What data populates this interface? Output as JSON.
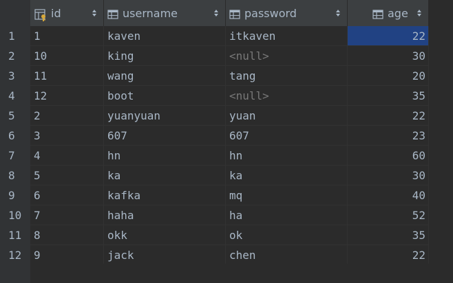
{
  "columns": [
    {
      "label": "id",
      "icon": "primary-key-column-icon"
    },
    {
      "label": "username",
      "icon": "table-column-icon"
    },
    {
      "label": "password",
      "icon": "table-column-icon"
    },
    {
      "label": "age",
      "icon": "table-column-icon"
    }
  ],
  "rows": [
    {
      "num": "1",
      "id": "1",
      "username": "kaven",
      "password": "itkaven",
      "age": "22"
    },
    {
      "num": "2",
      "id": "10",
      "username": "king",
      "password": "<null>",
      "age": "30"
    },
    {
      "num": "3",
      "id": "11",
      "username": "wang",
      "password": "tang",
      "age": "20"
    },
    {
      "num": "4",
      "id": "12",
      "username": "boot",
      "password": "<null>",
      "age": "35"
    },
    {
      "num": "5",
      "id": "2",
      "username": "yuanyuan",
      "password": "yuan",
      "age": "22"
    },
    {
      "num": "6",
      "id": "3",
      "username": "607",
      "password": "607",
      "age": "23"
    },
    {
      "num": "7",
      "id": "4",
      "username": "hn",
      "password": "hn",
      "age": "60"
    },
    {
      "num": "8",
      "id": "5",
      "username": "ka",
      "password": "ka",
      "age": "30"
    },
    {
      "num": "9",
      "id": "6",
      "username": "kafka",
      "password": "mq",
      "age": "40"
    },
    {
      "num": "10",
      "id": "7",
      "username": "haha",
      "password": "ha",
      "age": "52"
    },
    {
      "num": "11",
      "id": "8",
      "username": "okk",
      "password": "ok",
      "age": "35"
    },
    {
      "num": "12",
      "id": "9",
      "username": "jack",
      "password": "chen",
      "age": "22"
    }
  ],
  "selected_cell": {
    "row": 1,
    "column": "age"
  },
  "colors": {
    "background": "#2b2b2b",
    "header": "#3c3f41",
    "gutter": "#313335",
    "text": "#a9b7c6",
    "null_text": "#787878",
    "selection": "#214283"
  }
}
